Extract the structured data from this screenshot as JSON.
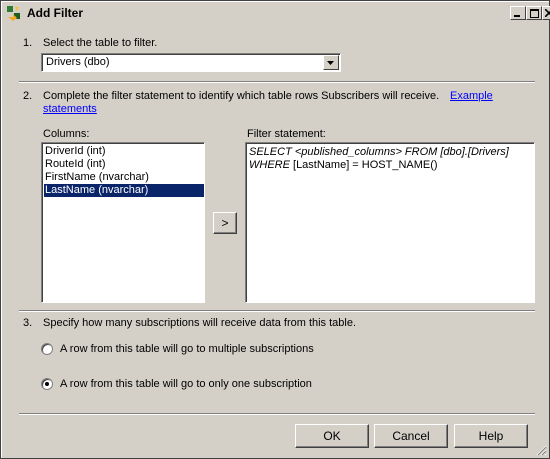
{
  "window": {
    "title": "Add Filter",
    "controls": {
      "minimize": "_",
      "maximize": "□",
      "close": "X"
    }
  },
  "step1": {
    "number": "1.",
    "label": "Select the table to filter.",
    "table_select": {
      "value": "Drivers (dbo)"
    }
  },
  "step2": {
    "number": "2.",
    "label": "Complete the filter statement to identify which table rows Subscribers will receive.",
    "link_part1": "Example",
    "link_part2": "statements",
    "columns_label": "Columns:",
    "columns": [
      {
        "label": "DriverId (int)",
        "selected": false
      },
      {
        "label": "RouteId (int)",
        "selected": false
      },
      {
        "label": "FirstName (nvarchar)",
        "selected": false
      },
      {
        "label": "LastName (nvarchar)",
        "selected": true
      }
    ],
    "add_button": ">",
    "filter_label": "Filter statement:",
    "filter_line1": "SELECT <published_columns> FROM [dbo].[Drivers]",
    "filter_line2_keyword": "WHERE",
    "filter_line2_rest": " [LastName] = HOST_NAME()"
  },
  "step3": {
    "number": "3.",
    "label": "Specify how many subscriptions will receive data from this table.",
    "options": [
      {
        "label": "A row from this table will go to multiple subscriptions",
        "checked": false
      },
      {
        "label": "A row from this table will go to only one subscription",
        "checked": true
      }
    ]
  },
  "buttons": {
    "ok": "OK",
    "cancel": "Cancel",
    "help": "Help"
  }
}
